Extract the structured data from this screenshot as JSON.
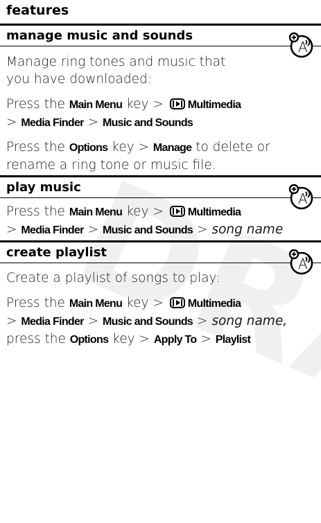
{
  "watermark": "DRAFT",
  "header": {
    "title": "features"
  },
  "sections": [
    {
      "title": "manage music and sounds",
      "icon": "network-feature-icon",
      "intro": [
        "Manage ring tones and music that",
        "you have downloaded:"
      ],
      "path": {
        "press": "Press the",
        "main_menu": "Main Menu",
        "key_gt": "key >",
        "multimedia": "Multimedia",
        "gt": ">",
        "media_finder": "Media Finder",
        "music_and_sounds": "Music and Sounds"
      },
      "options": {
        "press": "Press the",
        "options": "Options",
        "key_gt": "key >",
        "manage": "Manage",
        "line1_tail": "to delete or",
        "line2": "rename a ring tone or music file."
      }
    },
    {
      "title": "play music",
      "icon": "network-feature-icon",
      "path": {
        "press": "Press the",
        "main_menu": "Main Menu",
        "key_gt": "key >",
        "multimedia": "Multimedia",
        "gt": ">",
        "media_finder": "Media Finder",
        "music_and_sounds": "Music and Sounds",
        "song_name": "song name"
      }
    },
    {
      "title": "create playlist",
      "icon": "network-feature-icon",
      "intro": [
        "Create a playlist of songs to play:"
      ],
      "path": {
        "press": "Press the",
        "main_menu": "Main Menu",
        "key_gt": "key >",
        "multimedia": "Multimedia",
        "gt": ">",
        "media_finder": "Media Finder",
        "music_and_sounds": "Music and Sounds",
        "song_name": "song name,",
        "press_lower": "press the",
        "options": "Options",
        "apply_to": "Apply To",
        "playlist": "Playlist"
      }
    }
  ]
}
